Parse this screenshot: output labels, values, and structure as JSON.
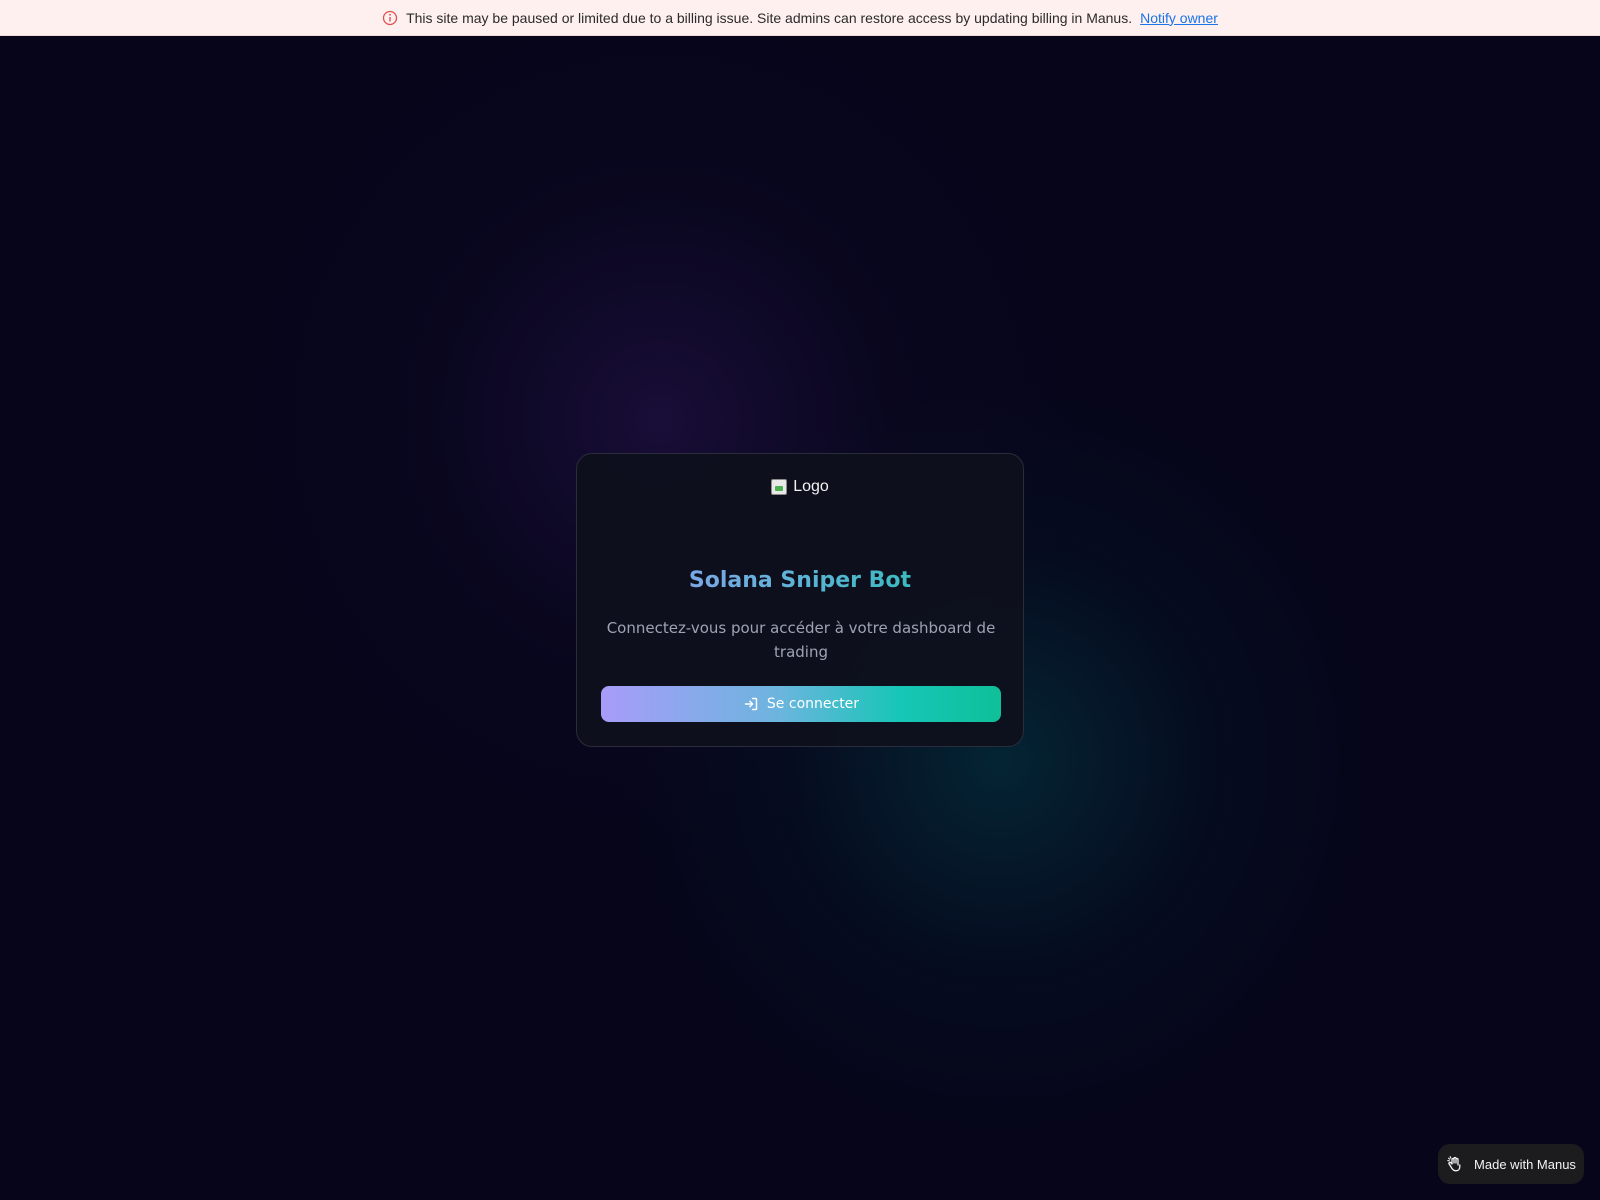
{
  "banner": {
    "icon": "info-icon",
    "message": "This site may be paused or limited due to a billing issue. Site admins can restore access by updating billing in Manus.",
    "link_label": "Notify owner"
  },
  "login_card": {
    "logo_alt": "Logo",
    "title": "Solana Sniper Bot",
    "subtitle": "Connectez-vous pour accéder à votre dashboard de trading",
    "button_label": "Se connecter",
    "button_icon": "login-icon"
  },
  "badge": {
    "label": "Made with Manus",
    "icon": "hand-icon"
  },
  "colors": {
    "background": "#06051a",
    "banner_bg": "#fdf0ef",
    "link": "#1a73e8",
    "gradient_start": "#a89cf9",
    "gradient_end": "#0fc09a",
    "subtitle": "#9ea3b4"
  }
}
